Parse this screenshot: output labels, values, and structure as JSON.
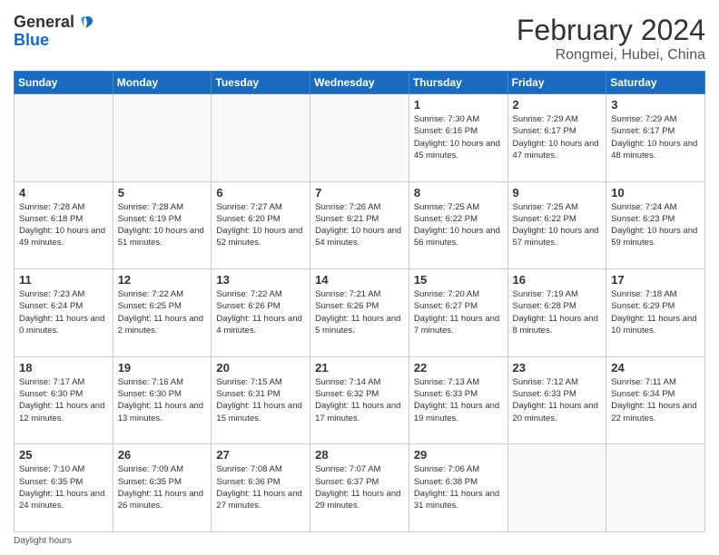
{
  "header": {
    "logo_line1": "General",
    "logo_line2": "Blue",
    "month_title": "February 2024",
    "location": "Rongmei, Hubei, China"
  },
  "weekdays": [
    "Sunday",
    "Monday",
    "Tuesday",
    "Wednesday",
    "Thursday",
    "Friday",
    "Saturday"
  ],
  "footer": {
    "daylight_label": "Daylight hours"
  },
  "weeks": [
    [
      {
        "day": "",
        "sunrise": "",
        "sunset": "",
        "daylight": ""
      },
      {
        "day": "",
        "sunrise": "",
        "sunset": "",
        "daylight": ""
      },
      {
        "day": "",
        "sunrise": "",
        "sunset": "",
        "daylight": ""
      },
      {
        "day": "",
        "sunrise": "",
        "sunset": "",
        "daylight": ""
      },
      {
        "day": "1",
        "sunrise": "Sunrise: 7:30 AM",
        "sunset": "Sunset: 6:16 PM",
        "daylight": "Daylight: 10 hours and 45 minutes."
      },
      {
        "day": "2",
        "sunrise": "Sunrise: 7:29 AM",
        "sunset": "Sunset: 6:17 PM",
        "daylight": "Daylight: 10 hours and 47 minutes."
      },
      {
        "day": "3",
        "sunrise": "Sunrise: 7:29 AM",
        "sunset": "Sunset: 6:17 PM",
        "daylight": "Daylight: 10 hours and 48 minutes."
      }
    ],
    [
      {
        "day": "4",
        "sunrise": "Sunrise: 7:28 AM",
        "sunset": "Sunset: 6:18 PM",
        "daylight": "Daylight: 10 hours and 49 minutes."
      },
      {
        "day": "5",
        "sunrise": "Sunrise: 7:28 AM",
        "sunset": "Sunset: 6:19 PM",
        "daylight": "Daylight: 10 hours and 51 minutes."
      },
      {
        "day": "6",
        "sunrise": "Sunrise: 7:27 AM",
        "sunset": "Sunset: 6:20 PM",
        "daylight": "Daylight: 10 hours and 52 minutes."
      },
      {
        "day": "7",
        "sunrise": "Sunrise: 7:26 AM",
        "sunset": "Sunset: 6:21 PM",
        "daylight": "Daylight: 10 hours and 54 minutes."
      },
      {
        "day": "8",
        "sunrise": "Sunrise: 7:25 AM",
        "sunset": "Sunset: 6:22 PM",
        "daylight": "Daylight: 10 hours and 56 minutes."
      },
      {
        "day": "9",
        "sunrise": "Sunrise: 7:25 AM",
        "sunset": "Sunset: 6:22 PM",
        "daylight": "Daylight: 10 hours and 57 minutes."
      },
      {
        "day": "10",
        "sunrise": "Sunrise: 7:24 AM",
        "sunset": "Sunset: 6:23 PM",
        "daylight": "Daylight: 10 hours and 59 minutes."
      }
    ],
    [
      {
        "day": "11",
        "sunrise": "Sunrise: 7:23 AM",
        "sunset": "Sunset: 6:24 PM",
        "daylight": "Daylight: 11 hours and 0 minutes."
      },
      {
        "day": "12",
        "sunrise": "Sunrise: 7:22 AM",
        "sunset": "Sunset: 6:25 PM",
        "daylight": "Daylight: 11 hours and 2 minutes."
      },
      {
        "day": "13",
        "sunrise": "Sunrise: 7:22 AM",
        "sunset": "Sunset: 6:26 PM",
        "daylight": "Daylight: 11 hours and 4 minutes."
      },
      {
        "day": "14",
        "sunrise": "Sunrise: 7:21 AM",
        "sunset": "Sunset: 6:26 PM",
        "daylight": "Daylight: 11 hours and 5 minutes."
      },
      {
        "day": "15",
        "sunrise": "Sunrise: 7:20 AM",
        "sunset": "Sunset: 6:27 PM",
        "daylight": "Daylight: 11 hours and 7 minutes."
      },
      {
        "day": "16",
        "sunrise": "Sunrise: 7:19 AM",
        "sunset": "Sunset: 6:28 PM",
        "daylight": "Daylight: 11 hours and 8 minutes."
      },
      {
        "day": "17",
        "sunrise": "Sunrise: 7:18 AM",
        "sunset": "Sunset: 6:29 PM",
        "daylight": "Daylight: 11 hours and 10 minutes."
      }
    ],
    [
      {
        "day": "18",
        "sunrise": "Sunrise: 7:17 AM",
        "sunset": "Sunset: 6:30 PM",
        "daylight": "Daylight: 11 hours and 12 minutes."
      },
      {
        "day": "19",
        "sunrise": "Sunrise: 7:16 AM",
        "sunset": "Sunset: 6:30 PM",
        "daylight": "Daylight: 11 hours and 13 minutes."
      },
      {
        "day": "20",
        "sunrise": "Sunrise: 7:15 AM",
        "sunset": "Sunset: 6:31 PM",
        "daylight": "Daylight: 11 hours and 15 minutes."
      },
      {
        "day": "21",
        "sunrise": "Sunrise: 7:14 AM",
        "sunset": "Sunset: 6:32 PM",
        "daylight": "Daylight: 11 hours and 17 minutes."
      },
      {
        "day": "22",
        "sunrise": "Sunrise: 7:13 AM",
        "sunset": "Sunset: 6:33 PM",
        "daylight": "Daylight: 11 hours and 19 minutes."
      },
      {
        "day": "23",
        "sunrise": "Sunrise: 7:12 AM",
        "sunset": "Sunset: 6:33 PM",
        "daylight": "Daylight: 11 hours and 20 minutes."
      },
      {
        "day": "24",
        "sunrise": "Sunrise: 7:11 AM",
        "sunset": "Sunset: 6:34 PM",
        "daylight": "Daylight: 11 hours and 22 minutes."
      }
    ],
    [
      {
        "day": "25",
        "sunrise": "Sunrise: 7:10 AM",
        "sunset": "Sunset: 6:35 PM",
        "daylight": "Daylight: 11 hours and 24 minutes."
      },
      {
        "day": "26",
        "sunrise": "Sunrise: 7:09 AM",
        "sunset": "Sunset: 6:35 PM",
        "daylight": "Daylight: 11 hours and 26 minutes."
      },
      {
        "day": "27",
        "sunrise": "Sunrise: 7:08 AM",
        "sunset": "Sunset: 6:36 PM",
        "daylight": "Daylight: 11 hours and 27 minutes."
      },
      {
        "day": "28",
        "sunrise": "Sunrise: 7:07 AM",
        "sunset": "Sunset: 6:37 PM",
        "daylight": "Daylight: 11 hours and 29 minutes."
      },
      {
        "day": "29",
        "sunrise": "Sunrise: 7:06 AM",
        "sunset": "Sunset: 6:38 PM",
        "daylight": "Daylight: 11 hours and 31 minutes."
      },
      {
        "day": "",
        "sunrise": "",
        "sunset": "",
        "daylight": ""
      },
      {
        "day": "",
        "sunrise": "",
        "sunset": "",
        "daylight": ""
      }
    ]
  ]
}
